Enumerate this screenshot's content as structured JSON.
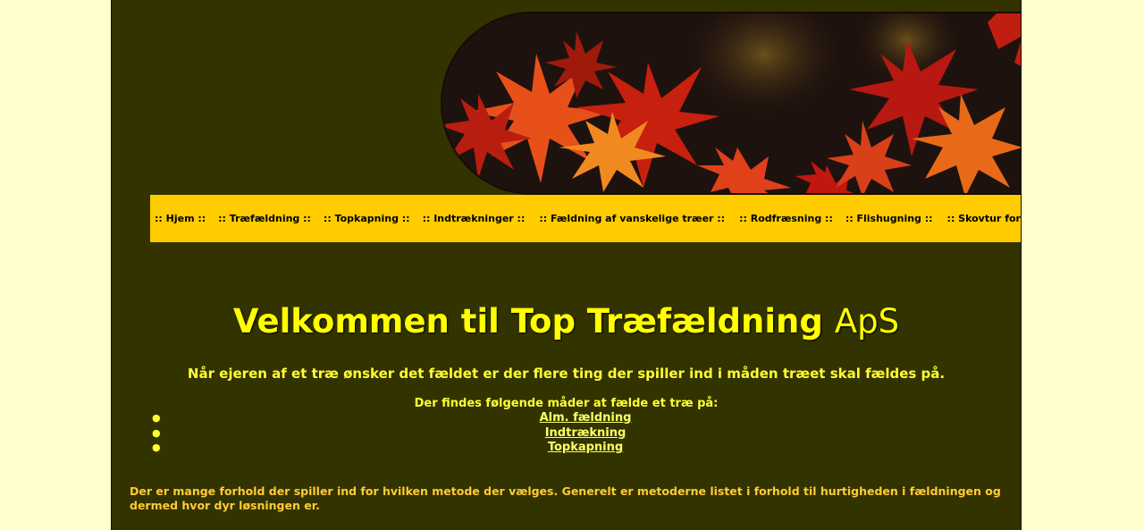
{
  "colors": {
    "page_background": "#ffffcc",
    "content_background": "#333300",
    "nav_background": "#ffcc00",
    "heading": "#ffff00",
    "text": "#ffcc33"
  },
  "banner": {
    "image": "autumn-maple-leaves-image"
  },
  "nav": {
    "items": [
      ":: Hjem ::",
      ":: Træfældning ::",
      ":: Topkapning ::",
      ":: Indtrækninger ::",
      ":: Fældning af vanskelige træer ::",
      ":: Rodfræsning ::",
      ":: Flishugning ::",
      ":: Skovtur for træklatrer ::"
    ]
  },
  "main": {
    "heading_bold": "Velkommen til Top Træfældning",
    "heading_normal": "ApS",
    "intro": "Når ejeren af et træ ønsker det fældet er der flere ting der spiller ind i måden træet skal fældes på.",
    "methods_title": "Der findes følgende måder at fælde et træ på:",
    "methods": [
      "Alm. fældning",
      "Indtrækning",
      "Topkapning"
    ],
    "body": "Der er mange forhold der spiller ind for hvilken metode der vælges. Generelt er metoderne listet i forhold til hurtigheden i fældningen og dermed hvor dyr løsningen er."
  }
}
